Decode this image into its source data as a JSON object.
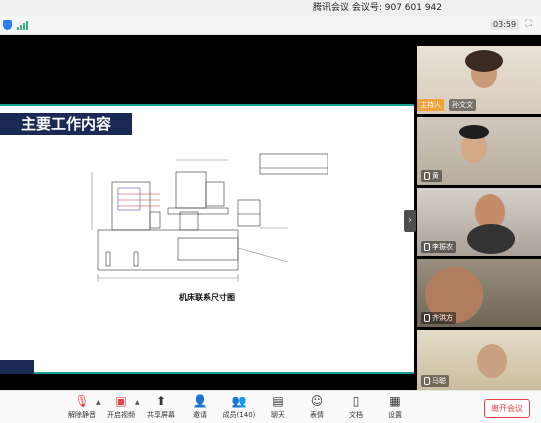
{
  "title_bar": {
    "text": "腾讯会议 会议号: 907 601 942"
  },
  "status": {
    "timer": "03:59",
    "fullscreen_icon": "fullscreen-icon",
    "shield_icon": "shield-icon",
    "signal_icon": "signal-icon"
  },
  "slide": {
    "title": "主要工作内容",
    "caption": "机床联系尺寸图",
    "colors": {
      "header_bg": "#1a2a55",
      "accent_line": "#17a097"
    }
  },
  "participants": [
    {
      "name": "孙文文",
      "host_badge": "主持人"
    },
    {
      "name": "黄"
    },
    {
      "name": "李振农"
    },
    {
      "name": "齐洪方"
    },
    {
      "name": "马聪"
    }
  ],
  "toolbar": {
    "unmute": "解除静音",
    "start_video": "开启视频",
    "share_screen": "共享屏幕",
    "invite": "邀请",
    "members": "成员(140)",
    "chat": "聊天",
    "reactions": "表情",
    "docs": "文档",
    "settings": "设置",
    "leave": "离开会议"
  },
  "colors": {
    "leave": "#e54545",
    "host_badge": "#f0a23b"
  }
}
